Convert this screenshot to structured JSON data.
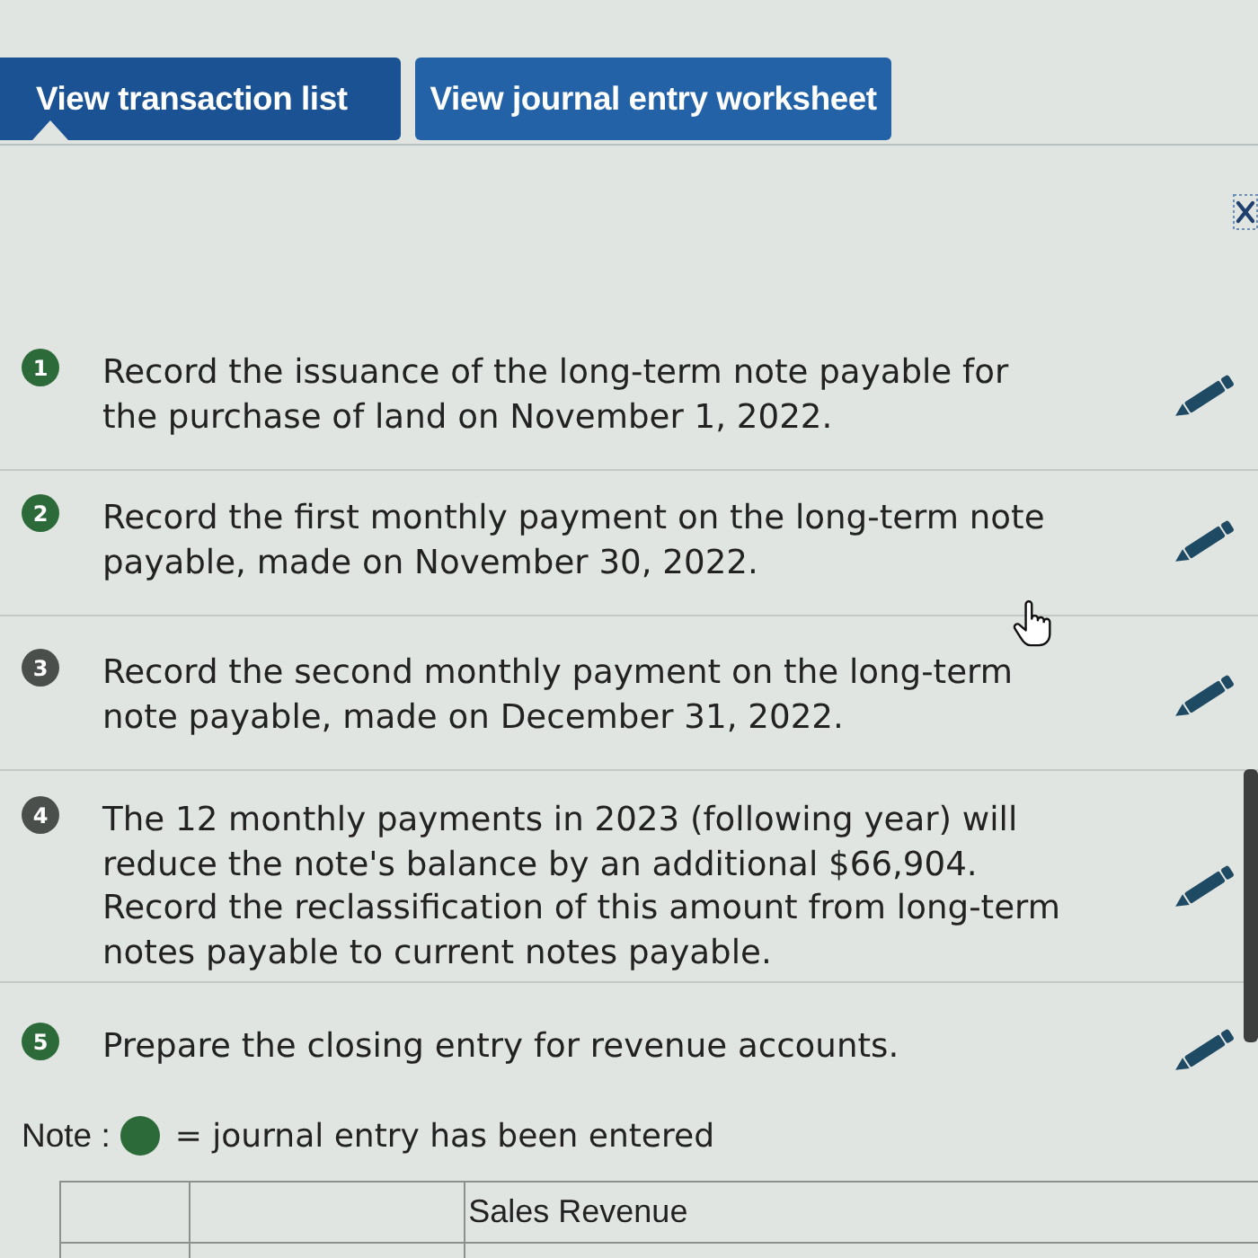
{
  "tabs": [
    {
      "label": "View transaction list",
      "selected": true
    },
    {
      "label": "View journal entry worksheet",
      "selected": false
    }
  ],
  "entries": [
    {
      "number": "1",
      "text": "Record the issuance of the long-term note payable for the purchase of land on November 1, 2022.",
      "entered": true
    },
    {
      "number": "2",
      "text": "Record the first monthly payment on the long-term note payable, made on November 30, 2022.",
      "entered": true
    },
    {
      "number": "3",
      "text": "Record the second monthly payment on the long-term note payable, made on December 31, 2022.",
      "entered": false
    },
    {
      "number": "4",
      "text": "The 12 monthly payments in 2023 (following year) will reduce the note's balance by an additional $66,904. Record the reclassification of this amount from long-term notes payable to current notes payable.",
      "entered": false
    },
    {
      "number": "5",
      "text": "Prepare the closing entry for revenue accounts.",
      "entered": true
    }
  ],
  "legend": {
    "label": "Note :",
    "text": "= journal entry has been entered"
  },
  "table": {
    "rows": [
      {
        "column_3": "Sales Revenue"
      }
    ]
  }
}
